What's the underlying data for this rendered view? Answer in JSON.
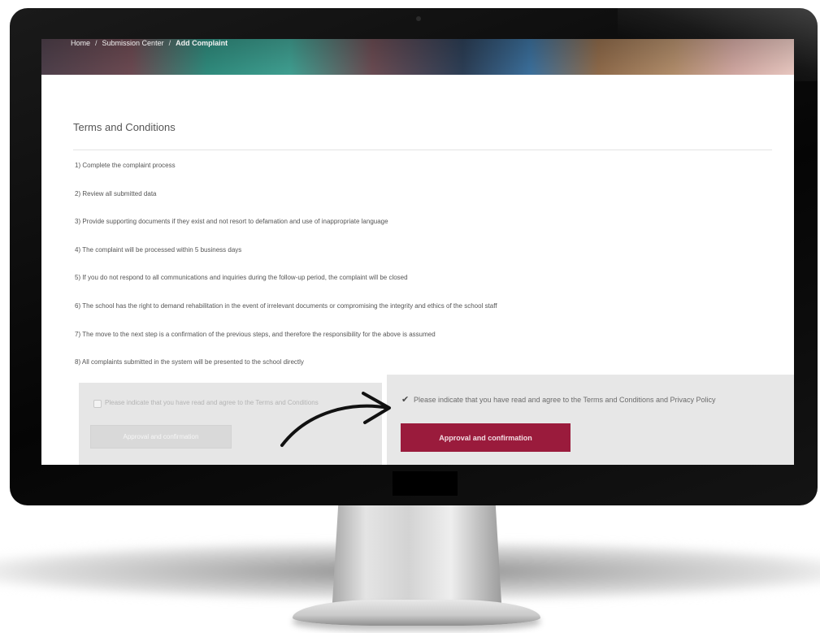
{
  "breadcrumb": {
    "items": [
      "Home",
      "Submission Center",
      "Add Complaint"
    ],
    "separator": "/"
  },
  "section_title": "Terms and Conditions",
  "terms": [
    "1) Complete the complaint process",
    "2) Review all submitted data",
    "3) Provide supporting documents if they exist and not resort to defamation and use of inappropriate language",
    "4) The complaint will be processed within 5 business days",
    "5) If you do not respond to all communications and inquiries during the follow-up period, the complaint will be closed",
    "6) The school has the right to demand rehabilitation in the event of irrelevant documents or compromising the integrity and ethics of the school staff",
    "7) The move to the next step is a confirmation of the previous steps, and therefore the responsibility for the above is assumed",
    "8) All complaints submitted in the system will be presented to the school directly"
  ],
  "panel_before": {
    "checkbox_label": "Please indicate that you have read and agree to the Terms and Conditions",
    "checked": false,
    "button_label": "Approval and confirmation"
  },
  "panel_after": {
    "checkbox_label": "Please indicate that you have read and agree to the Terms and Conditions and Privacy Policy",
    "checked": true,
    "checkmark": "✔",
    "button_label": "Approval and confirmation"
  },
  "colors": {
    "accent": "#9a1b3c",
    "bezel": "#0b0b0b",
    "panel": "#e7e7e7"
  }
}
